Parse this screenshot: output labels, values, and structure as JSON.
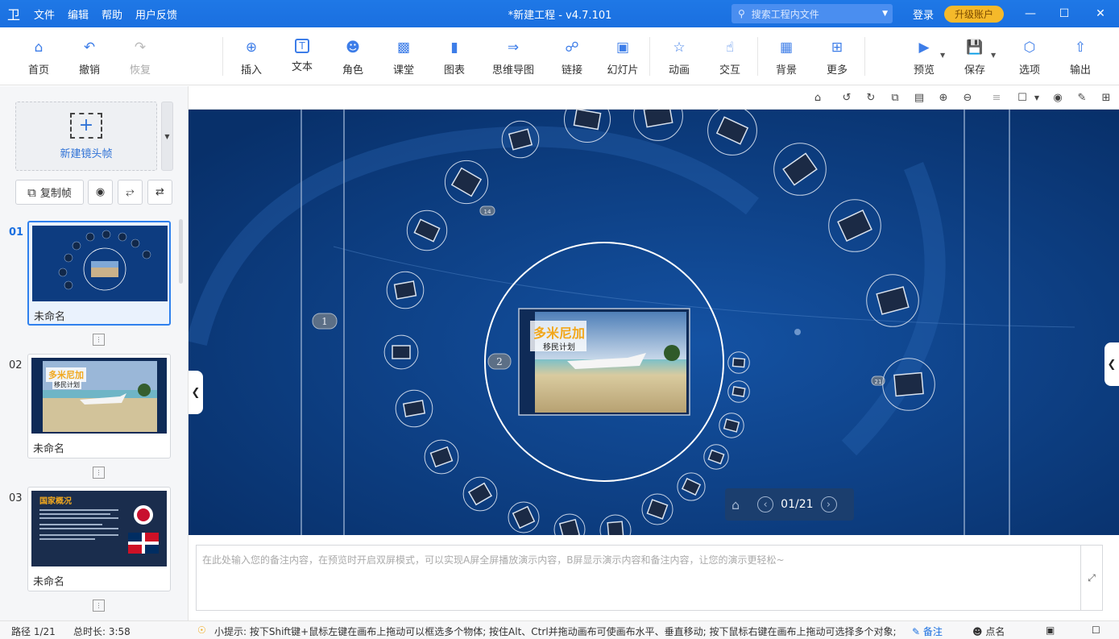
{
  "titlebar": {
    "logo": "卫",
    "menu": [
      "文件",
      "编辑",
      "帮助",
      "用户反馈"
    ],
    "title": "*新建工程 - v4.7.101",
    "search_placeholder": "搜索工程内文件",
    "login": "登录",
    "upgrade": "升级账户"
  },
  "toolbar": {
    "home": "首页",
    "undo": "撤销",
    "redo": "恢复",
    "insert": "插入",
    "text": "文本",
    "role": "角色",
    "class": "课堂",
    "chart": "图表",
    "mindmap": "思维导图",
    "link": "链接",
    "slides": "幻灯片",
    "animation": "动画",
    "interact": "交互",
    "background": "背景",
    "more": "更多",
    "preview": "预览",
    "save": "保存",
    "options": "选项",
    "export": "输出"
  },
  "leftpanel": {
    "new_frame": "新建镜头帧",
    "copy_frame": "复制帧",
    "slides": [
      {
        "num": "01",
        "name": "未命名"
      },
      {
        "num": "02",
        "name": "未命名",
        "title": "多米尼加",
        "subtitle": "移民计划"
      },
      {
        "num": "03",
        "name": "未命名",
        "title": "国家概况"
      }
    ]
  },
  "canvas": {
    "main_title": "多米尼加",
    "main_subtitle": "移民计划",
    "marker1": "1",
    "marker2": "2",
    "marker14": "14",
    "marker21": "21",
    "pager": "01/21"
  },
  "notes": {
    "placeholder": "在此处输入您的备注内容，在预览时开启双屏模式，可以实现A屏全屏播放演示内容，B屏显示演示内容和备注内容，让您的演示更轻松~"
  },
  "statusbar": {
    "path": "路径 1/21",
    "duration": "总时长: 3:58",
    "tip": "小提示: 按下Shift键+鼠标左键在画布上拖动可以框选多个物体; 按住Alt、Ctrl并拖动画布可使画布水平、垂直移动; 按下鼠标右键在画布上拖动可选择多个对象;",
    "notes": "备注",
    "rollcall": "点名"
  },
  "colors": {
    "accent": "#1a6fe0",
    "canvas_bg": "#0c3a7e",
    "upgrade": "#f5b92a"
  }
}
